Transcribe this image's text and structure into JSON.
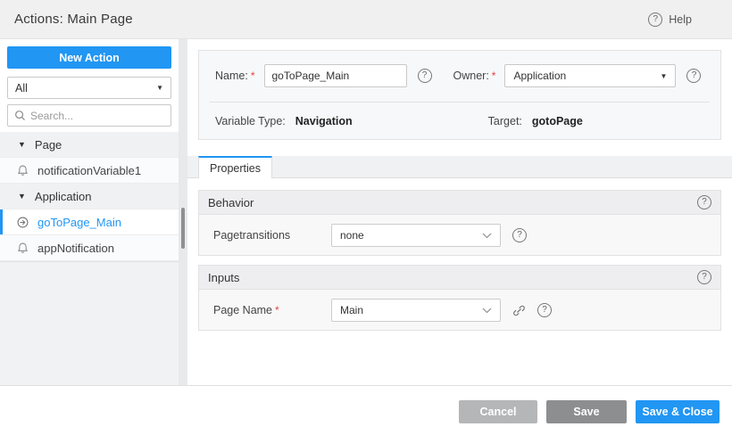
{
  "header": {
    "title": "Actions: Main Page",
    "help_label": "Help"
  },
  "icons": {
    "help_glyph": "?",
    "caret_down_glyph": "▼",
    "tree_collapse_glyph": "▼",
    "search_icon": "magnifier",
    "chevron_down_icon": "chevron-down",
    "link_icon": "chain-link",
    "notification_icon": "bell-outline",
    "goto_page_icon": "circle-arrow"
  },
  "required_marker": "*",
  "sidebar": {
    "new_action_label": "New Action",
    "filter_value": "All",
    "search_placeholder": "Search...",
    "tree": [
      {
        "type": "group",
        "label": "Page"
      },
      {
        "type": "item",
        "label": "notificationVariable1",
        "icon": "notification-icon",
        "selected": false
      },
      {
        "type": "group",
        "label": "Application"
      },
      {
        "type": "item",
        "label": "goToPage_Main",
        "icon": "goto-page-icon",
        "selected": true
      },
      {
        "type": "item",
        "label": "appNotification",
        "icon": "notification-icon",
        "selected": false
      }
    ]
  },
  "form": {
    "name_label": "Name:",
    "name_value": "goToPage_Main",
    "owner_label": "Owner:",
    "owner_value": "Application",
    "variable_type_label": "Variable Type:",
    "variable_type_value": "Navigation",
    "target_label": "Target:",
    "target_value": "gotoPage"
  },
  "tabs": [
    {
      "label": "Properties",
      "active": true
    }
  ],
  "sections": [
    {
      "title": "Behavior",
      "row": {
        "label": "Pagetransitions",
        "required": false,
        "value": "none"
      }
    },
    {
      "title": "Inputs",
      "row": {
        "label": "Page Name",
        "required": true,
        "value": "Main"
      }
    }
  ],
  "footer": {
    "cancel_label": "Cancel",
    "save_label": "Save",
    "save_close_label": "Save & Close"
  },
  "colors": {
    "accent": "#2196f3",
    "required_red": "#e5413e",
    "header_bg": "#f0f0f1",
    "section_header_bg": "#eeeef0",
    "panel_bg": "#f7f8f9",
    "cancel_btn": "#b5b6b7",
    "save_btn": "#8d8e8f"
  }
}
